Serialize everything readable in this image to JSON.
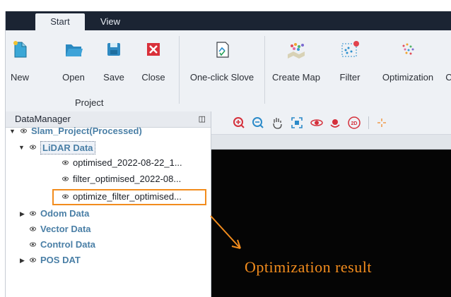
{
  "tabs": [
    {
      "label": "Start"
    },
    {
      "label": "View"
    }
  ],
  "ribbon": {
    "buttons": [
      {
        "label": "New",
        "icon": "new-file-icon"
      },
      {
        "label": "Open",
        "icon": "folder-open-icon"
      },
      {
        "label": "Save",
        "icon": "save-icon"
      },
      {
        "label": "Close",
        "icon": "close-icon"
      },
      {
        "label": "One-click Slove",
        "icon": "one-click-icon"
      },
      {
        "label": "Create Map",
        "icon": "map-icon"
      },
      {
        "label": "Filter",
        "icon": "filter-icon"
      },
      {
        "label": "Optimization",
        "icon": "optimization-icon"
      },
      {
        "label": "C",
        "icon": "truncated-icon"
      }
    ],
    "group_label": "Project"
  },
  "data_manager": {
    "title": "DataManager",
    "tree": [
      {
        "label": "Slam_Project(Processed)",
        "level": 0,
        "expanded": true
      },
      {
        "label": "LiDAR Data",
        "level": 1,
        "expanded": true
      },
      {
        "label": "optimised_2022-08-22_1...",
        "level": 2
      },
      {
        "label": "filter_optimised_2022-08...",
        "level": 2
      },
      {
        "label": "optimize_filter_optimised...",
        "level": 2
      },
      {
        "label": "Odom Data",
        "level": 1,
        "expanded": false
      },
      {
        "label": "Vector Data",
        "level": 1
      },
      {
        "label": "Control Data",
        "level": 1
      },
      {
        "label": "POS DAT",
        "level": 1,
        "expanded": false
      }
    ]
  },
  "viewer_toolbar": {
    "icons": [
      "zoom-in-icon",
      "zoom-out-icon",
      "pan-hand-icon",
      "fit-view-icon",
      "rotate-icon",
      "orbit-icon",
      "2d-view-icon",
      "crosshair-icon"
    ],
    "twod_label": "2D"
  },
  "annotation": "Optimization  result",
  "colors": {
    "highlight": "#f28c1d",
    "tree_blue": "#4a7fa6",
    "tab_bar": "#1b2433"
  }
}
